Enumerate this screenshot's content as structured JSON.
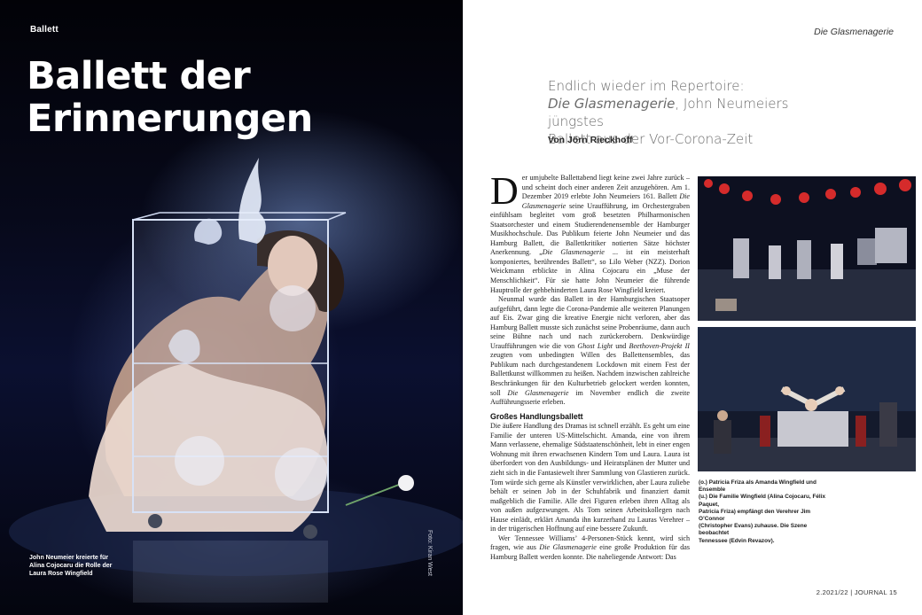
{
  "left_page": {
    "section_label": "Ballett",
    "title_line1": "Ballett der",
    "title_line2": "Erinnerungen",
    "photo_credit": "Foto: Kiran West",
    "caption_lines": [
      "John Neumeier kreierte für",
      "Alina Cojocaru die Rolle der",
      "Laura Rose Wingfield"
    ]
  },
  "right_page": {
    "running_head": "Die Glasmenagerie",
    "subtitle": {
      "line1": "Endlich wieder im Repertoire:",
      "line2_italic": "Die Glasmenagerie",
      "line2_rest": ", John Neumeiers jüngstes",
      "line3": "Ballett aus der Vor-Corona-Zeit"
    },
    "author": "Von Jörn Rieckhoff",
    "body": {
      "dropcap": "D",
      "p1_a": "er umjubelte Ballettabend liegt keine zwei Jahre zurück – und scheint doch einer anderen Zeit anzugehören. Am 1. Dezember 2019 erlebte John Neumeiers 161. Ballett ",
      "p1_italic": "Die Glasmenagerie",
      "p1_b": " seine Uraufführung, im Orchestergraben einfühlsam begleitet vom groß besetzten Philharmonischen Staatsorchester und einem Studierendenensemble der Hamburger Musikhochschule. Das Publikum feierte John Neumeier und das Hamburg Ballett, die Ballettkritiker notierten Sätze höchster Anerkennung. „",
      "p1_italic2": "Die Glasmenagerie",
      "p1_c": " ... ist ein meisterhaft komponiertes, berührendes Ballett“, so Lilo Weber (NZZ). Dorion Weickmann erblickte in Alina Cojocaru ein „Muse der Menschlichkeit“. Für sie hatte John Neumeier die führende Hauptrolle der gehbehinderten Laura Rose Wingfield kreiert.",
      "p2_a": "Neunmal wurde das Ballett in der Hamburgischen Staatsoper aufgeführt, dann legte die Corona-Pandemie alle weiteren Planungen auf Eis. Zwar ging die kreative Energie nicht verloren, aber das Hamburg Ballett musste sich zunächst seine Probenräume, dann auch seine Bühne nach und nach zurückerobern. Denkwürdige Uraufführungen wie die von ",
      "p2_italic": "Ghost Light",
      "p2_b": " und ",
      "p2_italic2": "Beethoven-Projekt II",
      "p2_c": " zeugten vom unbedingten Willen des Ballettensembles, das Publikum nach durchgestandenem Lockdown mit einem Fest der Ballettkunst willkommen zu heißen. Nachdem inzwischen zahlreiche Beschränkungen für den Kulturbetrieb gelockert werden konnten, soll ",
      "p2_italic3": "Die Glasmenagerie",
      "p2_d": " im November endlich die zweite Aufführungsserie erleben.",
      "subhead": "Großes Handlungsballett",
      "p3": "Die äußere Handlung des Dramas ist schnell erzählt. Es geht um eine Familie der unteren US-Mittelschicht. Amanda, eine von ihrem Mann verlassene, ehemalige Südstaatenschönheit, lebt in einer engen Wohnung mit ihren erwachsenen Kindern Tom und Laura. Laura ist überfordert von den Ausbildungs- und Heiratsplänen der Mutter und zieht sich in die Fantasiewelt ihrer Sammlung von Glastieren zurück. Tom würde sich gerne als Künstler verwirklichen, aber Laura zuliebe behält er seinen Job in der Schuhfabrik und finanziert damit maßgeblich die Familie. Alle drei Figuren erleben ihren Alltag als von außen aufgezwungen. Als Tom seinen Arbeitskollegen nach Hause einlädt, erklärt Amanda ihn kurzerhand zu Lauras Verehrer – in der trügerischen Hoffnung auf eine bessere Zukunft.",
      "p4_a": "Wer Tennessee Williams’ 4-Personen-Stück kennt, wird sich fragen, wie aus ",
      "p4_italic": "Die Glasmenagerie",
      "p4_b": " eine große Produktion für das Hamburg Ballett werden konnte. Die naheliegende Antwort: Das"
    },
    "photo_caption_lines": [
      "(o.) Patricia Friza als Amanda Wingfield und Ensemble",
      "(u.) Die Familie Wingfield (Alina Cojocaru, Félix Paquet,",
      "Patricia Friza) empfängt den Verehrer Jim O’Connor",
      "(Christopher Evans) zuhause. Die Szene beobachtet",
      "Tennessee (Edvin Revazov)."
    ],
    "folio": "2.2021/22 | JOURNAL 15"
  }
}
